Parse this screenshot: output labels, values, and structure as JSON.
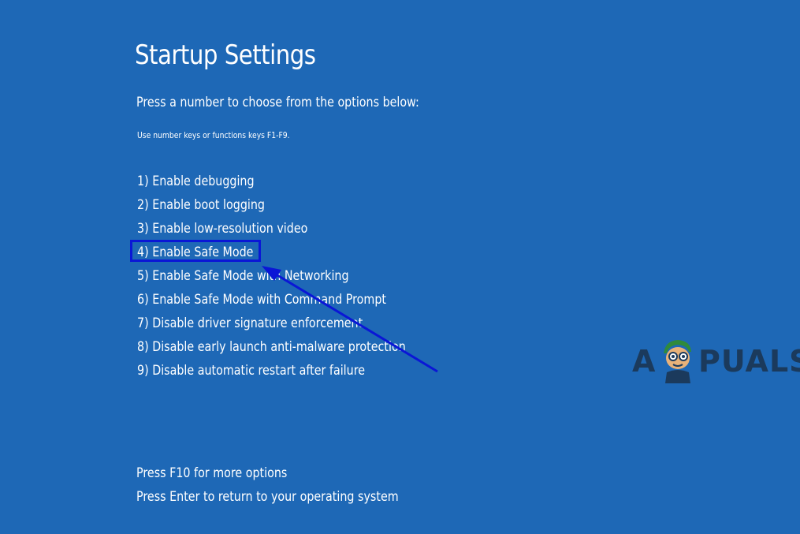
{
  "screen": {
    "title": "Startup Settings",
    "prompt": "Press a number to choose from the options below:",
    "hint": "Use number keys or functions keys F1-F9."
  },
  "options": [
    {
      "label": "1) Enable debugging"
    },
    {
      "label": "2) Enable boot logging"
    },
    {
      "label": "3) Enable low-resolution video"
    },
    {
      "label": "4) Enable Safe Mode",
      "highlighted": true
    },
    {
      "label": "5) Enable Safe Mode with Networking"
    },
    {
      "label": "6) Enable Safe Mode with Command Prompt"
    },
    {
      "label": "7) Disable driver signature enforcement"
    },
    {
      "label": "8) Disable early launch anti-malware protection"
    },
    {
      "label": "9) Disable automatic restart after failure"
    }
  ],
  "footer": {
    "more_options": "Press F10 for more options",
    "return": "Press Enter to return to your operating system"
  },
  "annotation": {
    "icon": "arrow-icon",
    "color": "#0a16d6"
  },
  "watermark": {
    "text_left": "A",
    "text_right": "PUALS",
    "icon": "mascot-logo-icon",
    "color": "#1b3a5c"
  },
  "colors": {
    "background": "#1e68b6",
    "text": "#ffffff",
    "highlight": "#0a16d6"
  }
}
